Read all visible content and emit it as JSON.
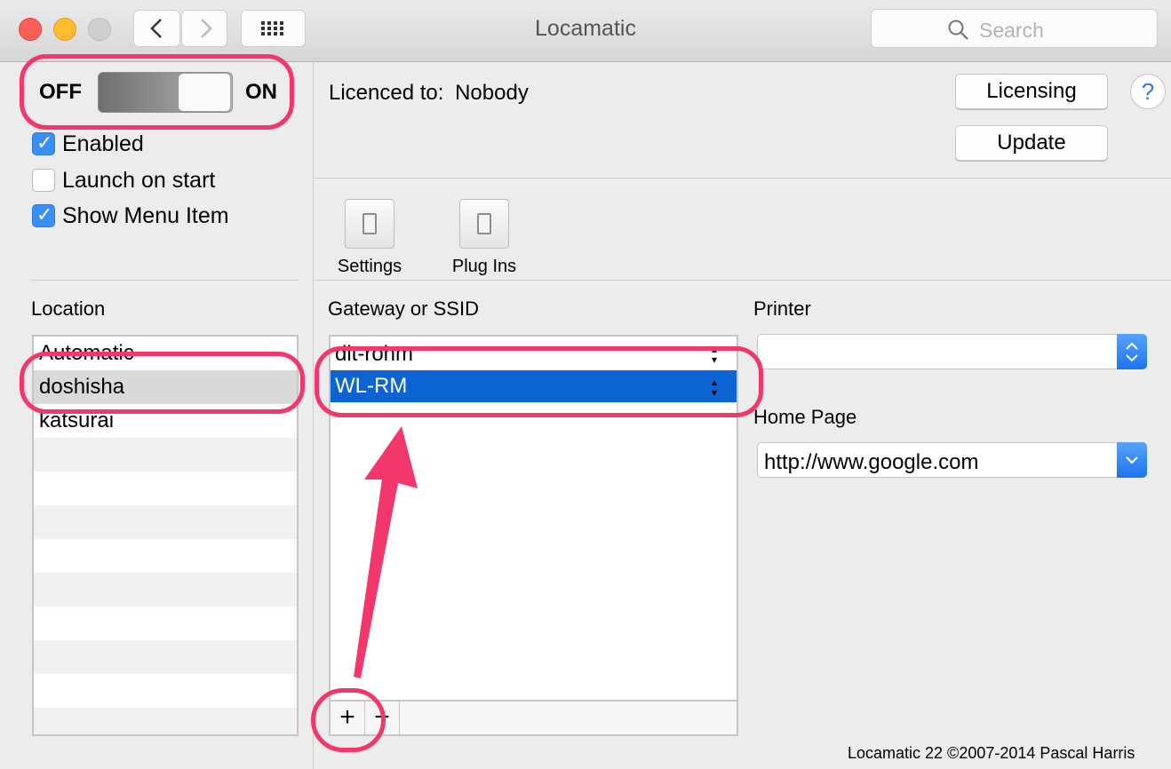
{
  "window": {
    "title": "Locamatic"
  },
  "search": {
    "placeholder": "Search"
  },
  "toggle": {
    "off_label": "OFF",
    "on_label": "ON",
    "state": "on"
  },
  "checkboxes": [
    {
      "label": "Enabled",
      "checked": true
    },
    {
      "label": "Launch on start",
      "checked": false
    },
    {
      "label": "Show Menu Item",
      "checked": true
    }
  ],
  "licence": {
    "label": "Licenced to:",
    "value": "Nobody"
  },
  "buttons": {
    "licensing": "Licensing",
    "update": "Update",
    "help": "?"
  },
  "toolbar": {
    "settings": "Settings",
    "plugins": "Plug Ins"
  },
  "location": {
    "header": "Location",
    "items": [
      "Automatic",
      "doshisha",
      "katsurai"
    ],
    "selected": "doshisha"
  },
  "ssid": {
    "header": "Gateway or SSID",
    "items": [
      "dit-rohm",
      "WL-RM"
    ],
    "selected": "WL-RM",
    "add": "+",
    "remove": "−"
  },
  "printer": {
    "label": "Printer",
    "value": ""
  },
  "homepage": {
    "label": "Home Page",
    "value": "http://www.google.com"
  },
  "footer": "Locamatic 22 ©2007-2014 Pascal Harris",
  "colors": {
    "accent": "#0c63d2",
    "annotation": "#f2376d",
    "checkbox": "#3a8ff5"
  }
}
